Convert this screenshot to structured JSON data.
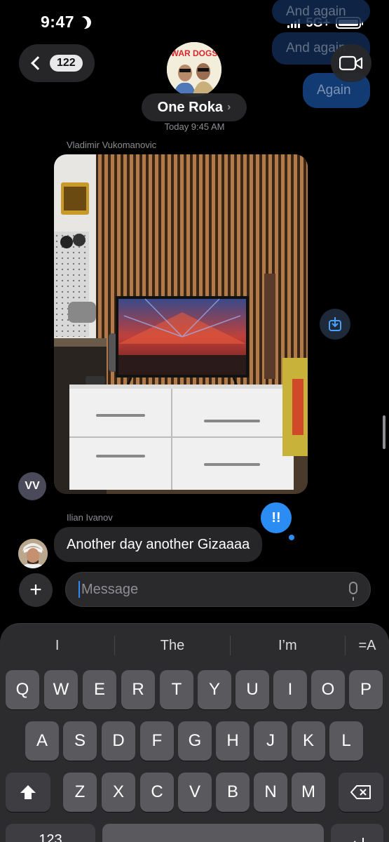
{
  "status_bar": {
    "time": "9:47",
    "network": "5G+"
  },
  "ghost_bubbles": [
    "And again",
    "And again",
    "Again"
  ],
  "header": {
    "back_count": "122",
    "contact_name": "One Roka",
    "avatar_text": "WAR DOGS",
    "timestamp": "Today 9:45 AM"
  },
  "messages": [
    {
      "sender": "Vladimir Vukomanovic",
      "type": "photo",
      "avatar_initials": "VV"
    },
    {
      "sender": "Ilian Ivanov",
      "type": "text",
      "text": "Another day another Gizaaaa",
      "tapback": "!!"
    }
  ],
  "input": {
    "placeholder": "Message"
  },
  "keyboard": {
    "suggestions": [
      "I",
      "The",
      "I’m"
    ],
    "format_icon": "=A",
    "row1": [
      "Q",
      "W",
      "E",
      "R",
      "T",
      "Y",
      "U",
      "I",
      "O",
      "P"
    ],
    "row2": [
      "A",
      "S",
      "D",
      "F",
      "G",
      "H",
      "J",
      "K",
      "L"
    ],
    "row3": [
      "Z",
      "X",
      "C",
      "V",
      "B",
      "N",
      "M"
    ],
    "numbers_key": "123"
  }
}
